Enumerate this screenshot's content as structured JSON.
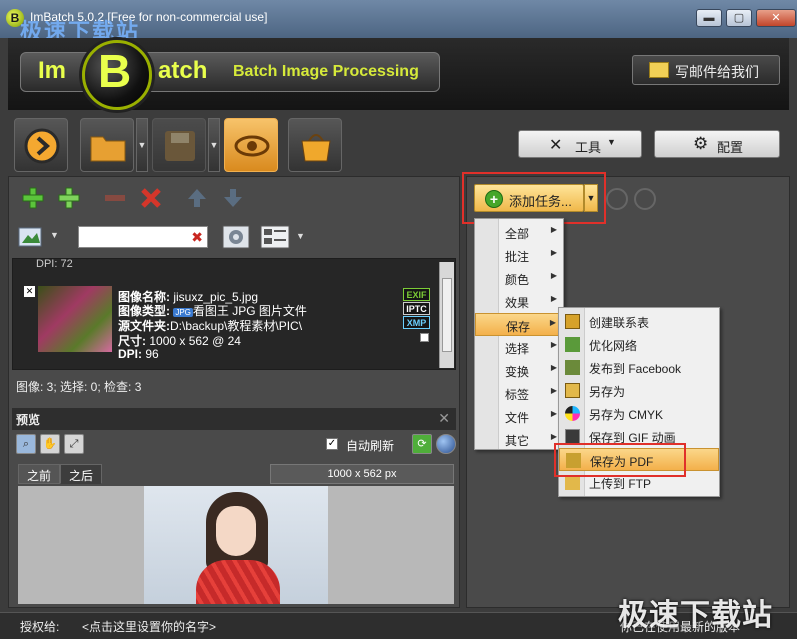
{
  "window": {
    "title": "ImBatch 5.0.2 [Free for non-commercial use]",
    "watermark_top": "极速下载站",
    "min": "▬",
    "max": "▢",
    "close": "✕"
  },
  "header": {
    "logo_im": "Im",
    "logo_b": "B",
    "logo_atch": "atch",
    "tagline": "Batch Image Processing",
    "mail_label": "写邮件给我们"
  },
  "toolbar": {
    "tools_label": "工具",
    "settings_label": "配置"
  },
  "search": {
    "value": ""
  },
  "file_list": {
    "top_stub": "DPI: 72",
    "item": {
      "name_label": "图像名称:",
      "name_value": "jisuxz_pic_5.jpg",
      "type_label": "图像类型:",
      "type_icon_text": "JPG",
      "type_value": "看图王 JPG 图片文件",
      "folder_label": "源文件夹:",
      "folder_value": "D:\\backup\\教程素材\\PIC\\",
      "size_label": "尺寸:",
      "size_value": "1000 x 562 @ 24",
      "dpi_label": "DPI:",
      "dpi_value": "96",
      "badges": [
        "EXIF",
        "IPTC",
        "XMP"
      ]
    }
  },
  "status_line": "图像: 3; 选择: 0; 检查: 3",
  "preview": {
    "title": "预览",
    "auto_refresh": "自动刷新",
    "tab_before": "之前",
    "tab_after": "之后",
    "dims": "1000 x 562 px"
  },
  "tasks": {
    "add_label": "添加任务...",
    "menu": [
      {
        "label": "全部"
      },
      {
        "label": "批注"
      },
      {
        "label": "颜色"
      },
      {
        "label": "效果"
      },
      {
        "label": "保存"
      },
      {
        "label": "选择"
      },
      {
        "label": "变换"
      },
      {
        "label": "标签"
      },
      {
        "label": "文件"
      },
      {
        "label": "其它"
      }
    ],
    "submenu": [
      {
        "label": "创建联系表"
      },
      {
        "label": "优化网络"
      },
      {
        "label": "发布到 Facebook"
      },
      {
        "label": "另存为"
      },
      {
        "label": "另存为 CMYK"
      },
      {
        "label": "保存到 GIF 动画"
      },
      {
        "label": "保存为 PDF"
      },
      {
        "label": "上传到 FTP"
      }
    ]
  },
  "bottom": {
    "license_label": "授权给:",
    "license_hint": "<点击这里设置你的名字>",
    "version_msg": "你已在使用最新的版本",
    "watermark": "极速下载站"
  },
  "colors": {
    "accent": "#f3b04a",
    "highlight_box": "#e0302a",
    "logo_green": "#e9ff4c"
  }
}
